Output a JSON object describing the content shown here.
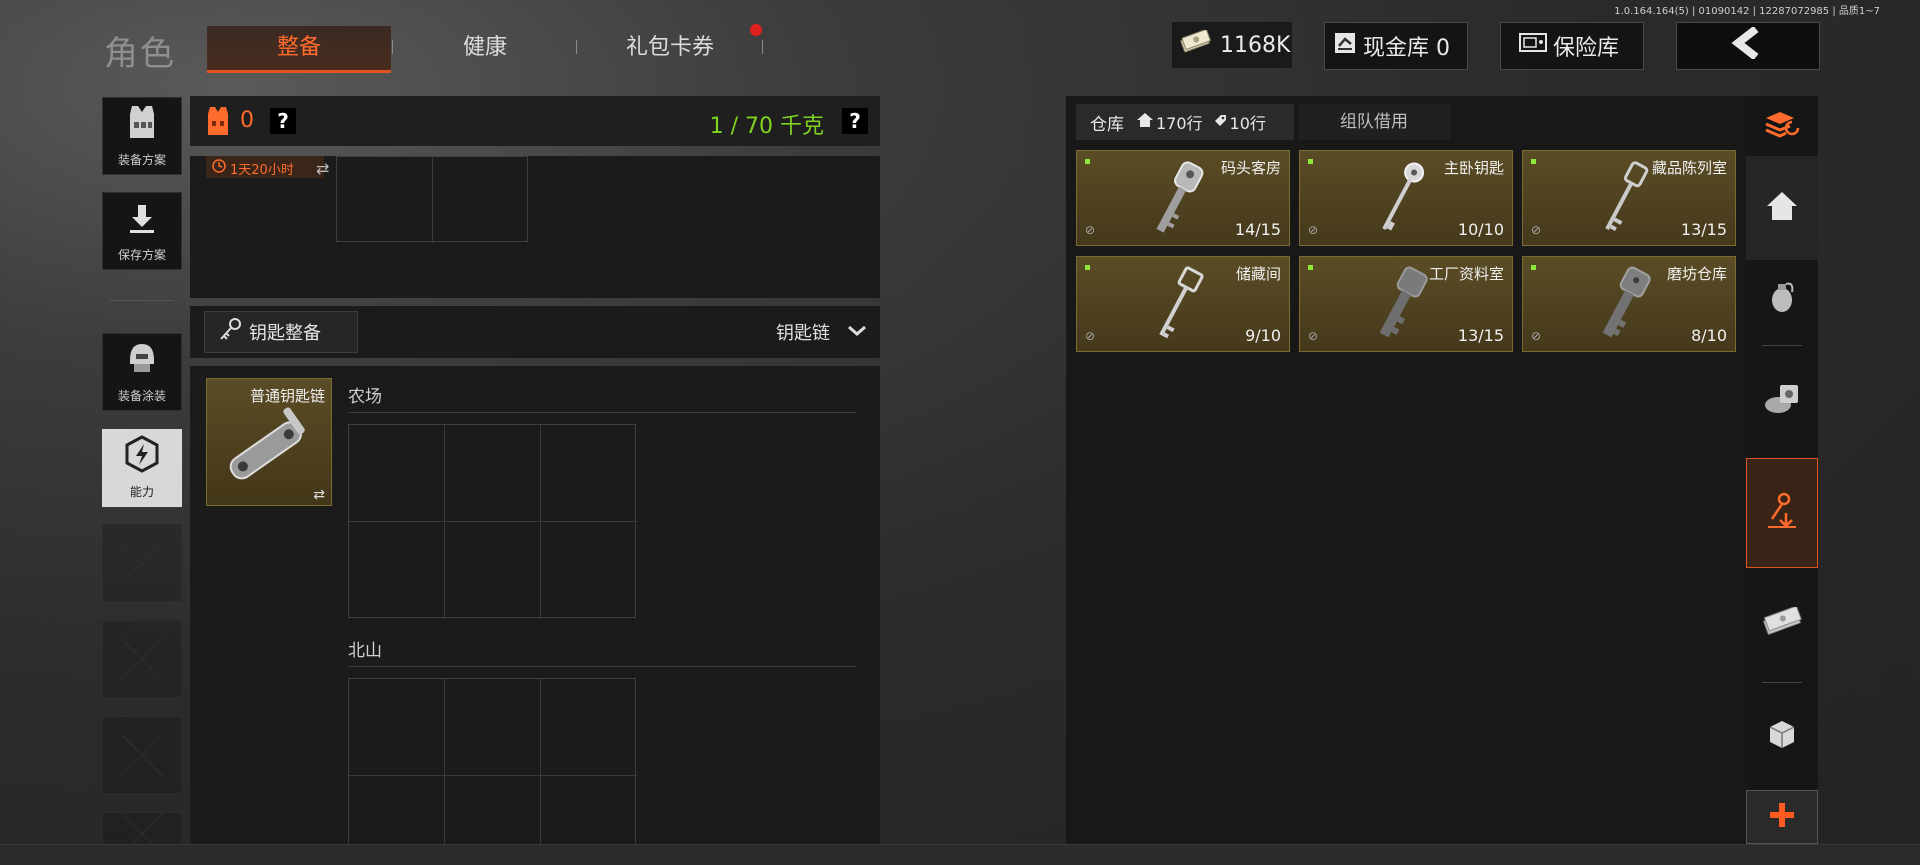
{
  "version": "1.0.164.164(5) | 01090142 | 12287072985 | 品质1~7",
  "header": {
    "title": "角色",
    "tabs": [
      {
        "label": "整备",
        "active": true
      },
      {
        "label": "健康",
        "active": false
      },
      {
        "label": "礼包卡券",
        "active": false,
        "badge": true
      }
    ],
    "money": "1168K",
    "cash_vault": "现金库 0",
    "safe_vault": "保险库"
  },
  "left_menu": [
    {
      "label": "装备方案",
      "icon": "vest-icon"
    },
    {
      "label": "保存方案",
      "icon": "download-icon"
    },
    {
      "label": "装备涂装",
      "icon": "helmet-icon"
    },
    {
      "label": "能力",
      "icon": "lightning-hex-icon",
      "active": true
    }
  ],
  "loadout": {
    "armor_count": "0",
    "weight": "1 / 70 千克",
    "timer": "1天20小时",
    "keychain_button": "钥匙整备",
    "keychain_dropdown": "钥匙链",
    "keychain_item": "普通钥匙链",
    "sections": [
      "农场",
      "北山"
    ]
  },
  "storage": {
    "tab_storage": "仓库",
    "rows": "170行",
    "key_rows": "10行",
    "tab_team": "组队借用",
    "keys": [
      {
        "name": "码头客房",
        "count": "14/15"
      },
      {
        "name": "主卧钥匙",
        "count": "10/10"
      },
      {
        "name": "藏品陈列室",
        "count": "13/15"
      },
      {
        "name": "储藏间",
        "count": "9/10"
      },
      {
        "name": "工厂资料室",
        "count": "13/15"
      },
      {
        "name": "磨坊仓库",
        "count": "8/10"
      }
    ]
  },
  "colors": {
    "accent": "#ff6b2c",
    "weight_green": "#7ed321",
    "key_card": "#4f4320"
  }
}
